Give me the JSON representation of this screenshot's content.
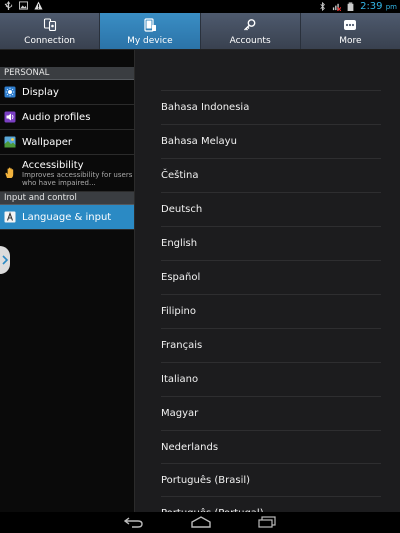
{
  "status_bar": {
    "time": "2:39",
    "time_suffix": "pm"
  },
  "tabs": [
    {
      "label": "Connection",
      "icon": "connection-icon"
    },
    {
      "label": "My device",
      "icon": "device-icon",
      "active": true
    },
    {
      "label": "Accounts",
      "icon": "key-icon"
    },
    {
      "label": "More",
      "icon": "more-icon"
    }
  ],
  "sidebar": {
    "sections": [
      {
        "header": "PERSONAL",
        "items": [
          {
            "label": "Display",
            "icon": "display-icon"
          },
          {
            "label": "Audio profiles",
            "icon": "speaker-icon"
          },
          {
            "label": "Wallpaper",
            "icon": "wallpaper-icon"
          },
          {
            "label": "Accessibility",
            "sub": "Improves accessibility for users who have impaired...",
            "icon": "hand-icon"
          }
        ]
      },
      {
        "header": "Input and control",
        "items": [
          {
            "label": "Language & input",
            "icon": "language-icon",
            "active": true
          }
        ]
      }
    ]
  },
  "languages": [
    "Bahasa Indonesia",
    "Bahasa Melayu",
    "Čeština",
    "Deutsch",
    "English",
    "Español",
    "Filipino",
    "Français",
    "Italiano",
    "Magyar",
    "Nederlands",
    "Português (Brasil)",
    "Português (Portugal)"
  ],
  "colors": {
    "accent": "#33b5e5",
    "active_tab": "#2b73a8",
    "active_item": "#2b8ac4"
  }
}
